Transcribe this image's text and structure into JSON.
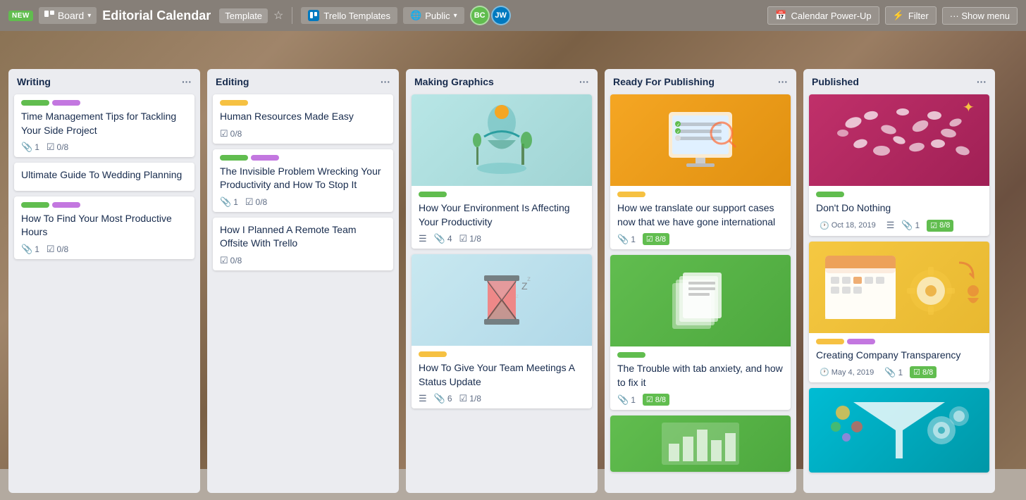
{
  "header": {
    "new_badge": "NEW",
    "board_label": "Board",
    "title": "Editorial Calendar",
    "template_label": "Template",
    "trello_templates_label": "Trello Templates",
    "public_label": "Public",
    "calendar_power_up_label": "Calendar Power-Up",
    "filter_label": "Filter",
    "show_menu_label": "Show menu",
    "avatars": [
      {
        "initials": "BC",
        "color": "#61bd4f"
      },
      {
        "initials": "JW",
        "color": "#0079bf"
      }
    ]
  },
  "columns": [
    {
      "id": "writing",
      "title": "Writing",
      "cards": [
        {
          "id": "w1",
          "labels": [
            {
              "color": "#61bd4f",
              "width": 40
            },
            {
              "color": "#c377e0",
              "width": 40
            }
          ],
          "title": "Time Management Tips for Tackling Your Side Project",
          "meta": [
            {
              "type": "clip",
              "value": "1"
            },
            {
              "type": "check",
              "value": "0/8",
              "green": false
            }
          ]
        },
        {
          "id": "w2",
          "labels": [],
          "title": "Ultimate Guide To Wedding Planning",
          "meta": []
        },
        {
          "id": "w3",
          "labels": [
            {
              "color": "#61bd4f",
              "width": 40
            },
            {
              "color": "#c377e0",
              "width": 40
            }
          ],
          "title": "How To Find Your Most Productive Hours",
          "meta": [
            {
              "type": "clip",
              "value": "1"
            },
            {
              "type": "check",
              "value": "0/8",
              "green": false
            }
          ]
        }
      ]
    },
    {
      "id": "editing",
      "title": "Editing",
      "cards": [
        {
          "id": "e1",
          "labels": [
            {
              "color": "#f6c142",
              "width": 40
            }
          ],
          "title": "Human Resources Made Easy",
          "meta": [
            {
              "type": "check",
              "value": "0/8",
              "green": false
            }
          ]
        },
        {
          "id": "e2",
          "labels": [
            {
              "color": "#61bd4f",
              "width": 40
            },
            {
              "color": "#c377e0",
              "width": 40
            }
          ],
          "title": "The Invisible Problem Wrecking Your Productivity and How To Stop It",
          "meta": [
            {
              "type": "clip",
              "value": "1"
            },
            {
              "type": "check",
              "value": "0/8",
              "green": false
            }
          ]
        },
        {
          "id": "e3",
          "labels": [],
          "title": "How I Planned A Remote Team Offsite With Trello",
          "meta": [
            {
              "type": "check",
              "value": "0/8",
              "green": false
            }
          ]
        }
      ]
    },
    {
      "id": "making-graphics",
      "title": "Making Graphics",
      "cards": [
        {
          "id": "mg1",
          "image": "meditation",
          "labels": [
            {
              "color": "#61bd4f",
              "width": 40
            }
          ],
          "title": "How Your Environment Is Affecting Your Productivity",
          "meta": [
            {
              "type": "clip",
              "value": "4"
            },
            {
              "type": "check",
              "value": "1/8",
              "green": false
            }
          ]
        },
        {
          "id": "mg2",
          "image": "hourglass",
          "labels": [
            {
              "color": "#f6c142",
              "width": 40
            }
          ],
          "title": "How To Give Your Team Meetings A Status Update",
          "meta": [
            {
              "type": "clip",
              "value": "6"
            },
            {
              "type": "check",
              "value": "1/8",
              "green": false
            }
          ]
        }
      ]
    },
    {
      "id": "ready-for-publishing",
      "title": "Ready For Publishing",
      "cards": [
        {
          "id": "rfp1",
          "image": "computer",
          "labels": [
            {
              "color": "#f6c142",
              "width": 40
            }
          ],
          "title": "How we translate our support cases now that we have gone international",
          "meta": [
            {
              "type": "clip",
              "value": "1"
            },
            {
              "type": "check",
              "value": "8/8",
              "green": true
            }
          ]
        },
        {
          "id": "rfp2",
          "image": "pages",
          "labels": [
            {
              "color": "#61bd4f",
              "width": 40
            }
          ],
          "title": "The Trouble with tab anxiety, and how to fix it",
          "meta": [
            {
              "type": "clip",
              "value": "1"
            },
            {
              "type": "check",
              "value": "8/8",
              "green": true
            }
          ]
        },
        {
          "id": "rfp3",
          "image": "green-chart",
          "labels": [],
          "title": "",
          "meta": []
        }
      ]
    },
    {
      "id": "published",
      "title": "Published",
      "cards": [
        {
          "id": "p1",
          "image": "fish",
          "labels": [
            {
              "color": "#61bd4f",
              "width": 40
            }
          ],
          "title": "Don't Do Nothing",
          "meta": [
            {
              "type": "date",
              "value": "Oct 18, 2019",
              "overdue": false
            },
            {
              "type": "clip",
              "value": "1"
            },
            {
              "type": "check",
              "value": "8/8",
              "green": true
            }
          ]
        },
        {
          "id": "p2",
          "image": "calendar",
          "labels": [
            {
              "color": "#f6c142",
              "width": 40
            },
            {
              "color": "#c377e0",
              "width": 40
            }
          ],
          "title": "Creating Company Transparency",
          "meta": [
            {
              "type": "date",
              "value": "May 4, 2019",
              "overdue": false
            },
            {
              "type": "clip",
              "value": "1"
            },
            {
              "type": "check",
              "value": "8/8",
              "green": true
            }
          ]
        },
        {
          "id": "p3",
          "image": "funnel",
          "labels": [],
          "title": "",
          "meta": []
        }
      ]
    }
  ]
}
